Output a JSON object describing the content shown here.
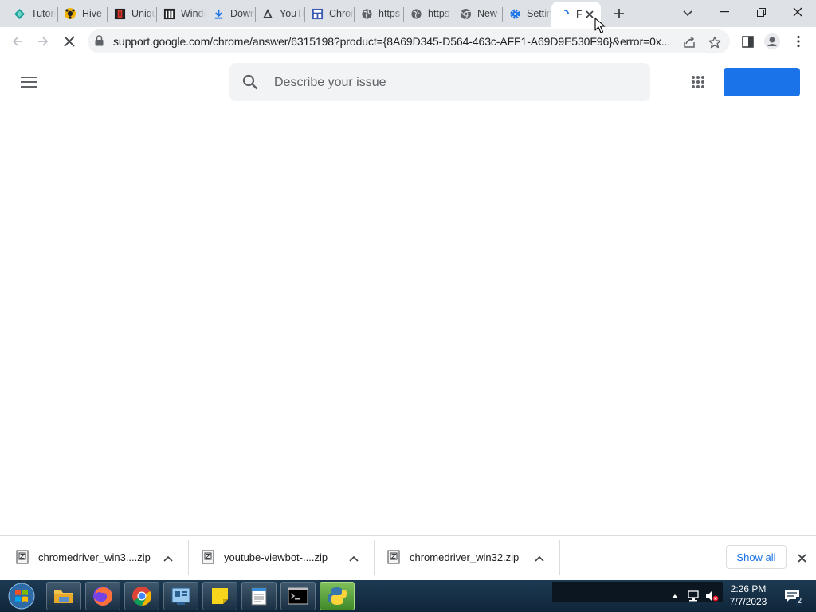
{
  "tabs": [
    {
      "label": "Tutorial",
      "icon": "tutorial-favicon-icon"
    },
    {
      "label": "Hive",
      "icon": "hive-favicon-icon"
    },
    {
      "label": "Unique",
      "icon": "unique-favicon-icon"
    },
    {
      "label": "Windows",
      "icon": "windows-favicon-icon"
    },
    {
      "label": "Download",
      "icon": "download-favicon-icon"
    },
    {
      "label": "YouTube",
      "icon": "youtube-favicon-icon"
    },
    {
      "label": "Chrome",
      "icon": "chrome-web-favicon-icon"
    },
    {
      "label": "https",
      "icon": "globe-icon"
    },
    {
      "label": "https",
      "icon": "globe-icon"
    },
    {
      "label": "New",
      "icon": "chrome-favicon-icon"
    },
    {
      "label": "Settings",
      "icon": "settings-gear-icon"
    },
    {
      "label": "F",
      "icon": "loading-spinner-icon",
      "active": true
    }
  ],
  "toolbar": {
    "url": "support.google.com/chrome/answer/6315198?product={8A69D345-D564-463c-AFF1-A69D9E530F96}&error=0x..."
  },
  "page": {
    "search_placeholder": "Describe your issue",
    "signin_label": ""
  },
  "downloads": {
    "items": [
      {
        "name": "chromedriver_win3....zip"
      },
      {
        "name": "youtube-viewbot-....zip"
      },
      {
        "name": "chromedriver_win32.zip"
      }
    ],
    "show_all": "Show all"
  },
  "taskbar": {
    "time": "2:26 PM",
    "date": "7/7/2023",
    "notification_count": "2",
    "apps": [
      "file-explorer",
      "firefox",
      "chrome",
      "control-panel",
      "sticky-notes",
      "notepad",
      "command-prompt",
      "python"
    ]
  },
  "colors": {
    "accent": "#1a73e8",
    "tab_strip": "#dee1e6",
    "omnibox": "#f1f3f4",
    "taskbar": "#14304a"
  }
}
